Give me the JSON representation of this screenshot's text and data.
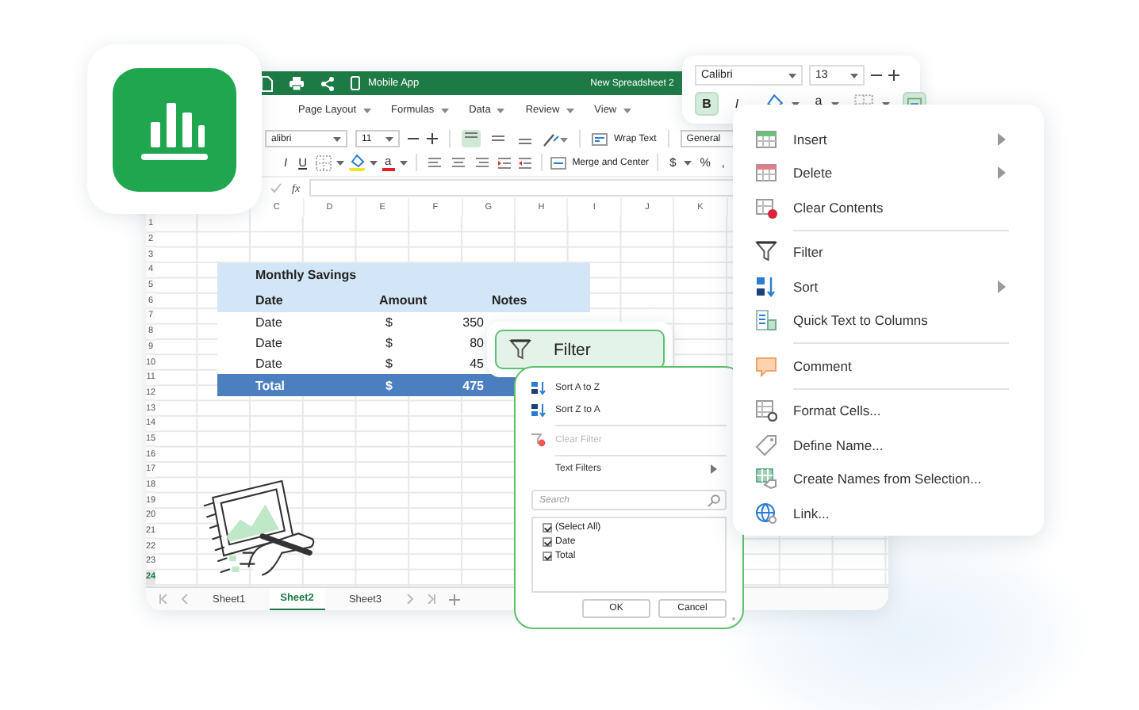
{
  "app": {
    "mobile_label": "Mobile App",
    "title": "New Spreadsheet 2"
  },
  "menu_tabs": [
    "Page Layout",
    "Formulas",
    "Data",
    "Review",
    "View"
  ],
  "ribbon": {
    "font": "alibri",
    "size": "11",
    "align_buttons": [
      {
        "on": true
      },
      {
        "on": false
      },
      {
        "on": false
      }
    ],
    "format_buttons": [
      {
        "kind": "italic",
        "label": "I"
      },
      {
        "kind": "underline",
        "label": "U"
      },
      {
        "kind": "borders"
      },
      {
        "kind": "fill"
      },
      {
        "kind": "font_color",
        "label": "a"
      }
    ],
    "wrap_label": "Wrap Text",
    "merge_label": "Merge and Center",
    "number_format": "General",
    "number_buttons": [
      "$",
      "%",
      ","
    ]
  },
  "formula_bar": {
    "label": "fx"
  },
  "column_headers": [
    "C",
    "D",
    "E",
    "F",
    "G",
    "H",
    "I",
    "J",
    "K"
  ],
  "row_numbers": [
    {
      "label": "1",
      "selected": false
    },
    {
      "label": "2",
      "selected": false
    },
    {
      "label": "3",
      "selected": false
    },
    {
      "label": "4",
      "selected": false
    },
    {
      "label": "5",
      "selected": false
    },
    {
      "label": "6",
      "selected": false
    },
    {
      "label": "7",
      "selected": false
    },
    {
      "label": "8",
      "selected": false
    },
    {
      "label": "9",
      "selected": false
    },
    {
      "label": "10",
      "selected": false
    },
    {
      "label": "11",
      "selected": false
    },
    {
      "label": "12",
      "selected": false
    },
    {
      "label": "13",
      "selected": false
    },
    {
      "label": "14",
      "selected": false
    },
    {
      "label": "15",
      "selected": false
    },
    {
      "label": "16",
      "selected": false
    },
    {
      "label": "17",
      "selected": false
    },
    {
      "label": "18",
      "selected": false
    },
    {
      "label": "19",
      "selected": false
    },
    {
      "label": "20",
      "selected": false
    },
    {
      "label": "21",
      "selected": false
    },
    {
      "label": "22",
      "selected": false
    },
    {
      "label": "23",
      "selected": false
    },
    {
      "label": "24",
      "selected": true
    }
  ],
  "table": {
    "title": "Monthly Savings",
    "headers": [
      "Date",
      "Amount",
      "Notes"
    ],
    "rows": [
      {
        "date": "Date",
        "currency": "$",
        "amount": "350"
      },
      {
        "date": "Date",
        "currency": "$",
        "amount": "80"
      },
      {
        "date": "Date",
        "currency": "$",
        "amount": "45"
      }
    ],
    "total": {
      "label": "Total",
      "currency": "$",
      "amount": "475"
    }
  },
  "sheet_tabs": [
    {
      "label": "Sheet1",
      "selected": false
    },
    {
      "label": "Sheet2",
      "selected": true
    },
    {
      "label": "Sheet3",
      "selected": false
    }
  ],
  "mini_toolbar": {
    "font": "Calibri",
    "size": "13",
    "buttons": [
      {
        "kind": "bold",
        "label": "B",
        "on": true
      },
      {
        "kind": "italic",
        "label": "I",
        "on": false
      },
      {
        "kind": "fill",
        "on": false
      },
      {
        "kind": "font_color",
        "label": "a",
        "on": false
      },
      {
        "kind": "borders",
        "on": false
      },
      {
        "kind": "merge",
        "on": true
      }
    ]
  },
  "context_menu": {
    "groups": [
      [
        {
          "kind": "insert",
          "label": "Insert",
          "submenu": true
        },
        {
          "kind": "delete",
          "label": "Delete",
          "submenu": true
        },
        {
          "kind": "clear",
          "label": "Clear Contents",
          "submenu": false
        }
      ],
      [
        {
          "kind": "filter",
          "label": "Filter",
          "submenu": false
        },
        {
          "kind": "sort",
          "label": "Sort",
          "submenu": true
        },
        {
          "kind": "text_columns",
          "label": "Quick Text to Columns",
          "submenu": false
        }
      ],
      [
        {
          "kind": "comment",
          "label": "Comment",
          "submenu": false
        }
      ],
      [
        {
          "kind": "format_cells",
          "label": "Format Cells...",
          "submenu": false
        },
        {
          "kind": "define_name",
          "label": "Define Name...",
          "submenu": false
        },
        {
          "kind": "create_names",
          "label": "Create Names from Selection...",
          "submenu": false
        },
        {
          "kind": "link",
          "label": "Link...",
          "submenu": false
        }
      ]
    ]
  },
  "filter_button": {
    "label": "Filter"
  },
  "filter_menu": {
    "items": [
      {
        "kind": "sort_asc",
        "label": "Sort A to Z",
        "disabled": false
      },
      {
        "kind": "sort_desc",
        "label": "Sort Z to A",
        "disabled": false
      },
      {
        "kind": "clear",
        "label": "Clear Filter",
        "disabled": true
      },
      {
        "kind": "submenu",
        "label": "Text Filters",
        "disabled": false
      }
    ],
    "search_placeholder": "Search",
    "values": [
      {
        "label": "(Select All)",
        "checked": true
      },
      {
        "label": "Date",
        "checked": true
      },
      {
        "label": "Total",
        "checked": true
      }
    ],
    "buttons": [
      "OK",
      "Cancel"
    ]
  }
}
